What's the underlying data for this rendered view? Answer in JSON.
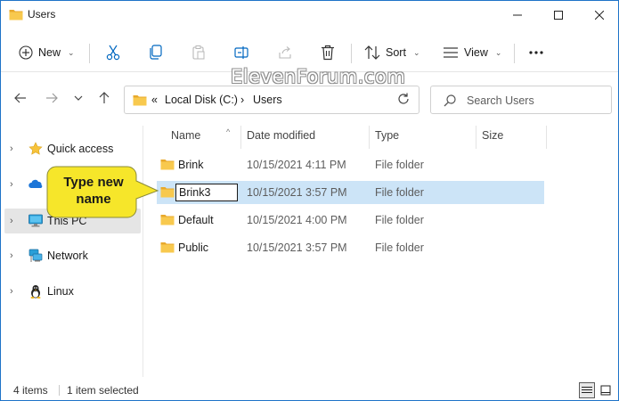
{
  "window": {
    "title": "Users"
  },
  "titlebar": {
    "minimize_icon": "minimize-icon",
    "maximize_icon": "maximize-icon",
    "close_icon": "close-icon"
  },
  "ribbon": {
    "new_label": "New",
    "sort_label": "Sort",
    "view_label": "View",
    "icons": [
      "plus-icon",
      "cut-icon",
      "copy-icon",
      "paste-icon",
      "rename-icon",
      "share-icon",
      "delete-icon",
      "sort-icon",
      "view-icon",
      "more-icon"
    ]
  },
  "address": {
    "overflow": "«",
    "crumbs": [
      "Local Disk (C:)",
      "Users"
    ],
    "separator": "›"
  },
  "search": {
    "placeholder": "Search Users"
  },
  "watermark": "ElevenForum.com",
  "nav": {
    "items": [
      {
        "label": "Quick access",
        "icon": "star-icon"
      },
      {
        "label": "",
        "icon": "onedrive-icon"
      },
      {
        "label": "This PC",
        "icon": "pc-icon",
        "selected": true
      },
      {
        "label": "Network",
        "icon": "network-icon"
      },
      {
        "label": "Linux",
        "icon": "linux-icon"
      }
    ]
  },
  "columns": {
    "name": "Name",
    "date": "Date modified",
    "type": "Type",
    "size": "Size"
  },
  "rows": [
    {
      "name": "Brink",
      "date": "10/15/2021 4:11 PM",
      "type": "File folder"
    },
    {
      "name": "Brink3",
      "date": "10/15/2021 3:57 PM",
      "type": "File folder",
      "selected": true,
      "renaming": true
    },
    {
      "name": "Default",
      "date": "10/15/2021 4:00 PM",
      "type": "File folder"
    },
    {
      "name": "Public",
      "date": "10/15/2021 3:57 PM",
      "type": "File folder"
    }
  ],
  "callout": {
    "line1": "Type new",
    "line2": "name"
  },
  "status": {
    "count": "4 items",
    "selection": "1 item selected"
  },
  "colors": {
    "accent": "#0067c0",
    "selection": "#cce4f7",
    "folder": "#f5c24c",
    "callout": "#f6e62a"
  }
}
